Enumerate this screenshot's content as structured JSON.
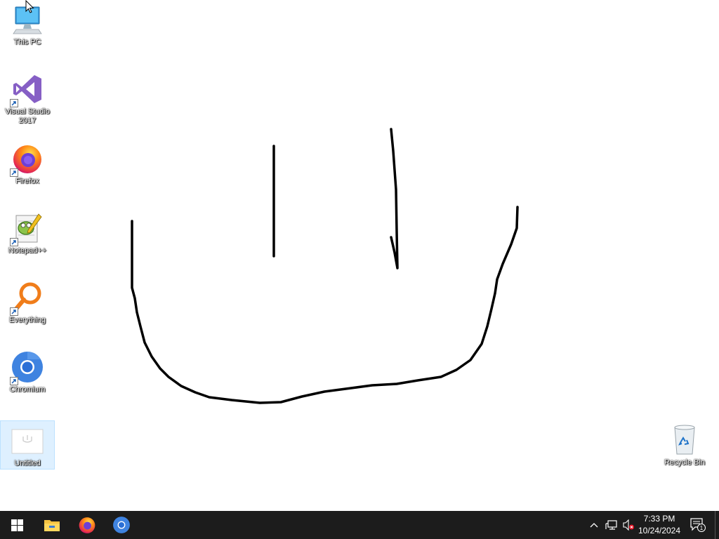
{
  "desktop": {
    "icons": [
      {
        "label": "This PC",
        "icon": "monitor-icon"
      },
      {
        "label": "Visual Studio 2017",
        "icon": "visual-studio-icon"
      },
      {
        "label": "Firefox",
        "icon": "firefox-icon"
      },
      {
        "label": "Notepad++",
        "icon": "notepad-plus-plus-icon"
      },
      {
        "label": "Everything",
        "icon": "magnifier-icon"
      },
      {
        "label": "Chromium",
        "icon": "chromium-icon"
      },
      {
        "label": "Untitled",
        "icon": "blank-document-icon"
      }
    ],
    "recycle_bin": {
      "label": "Recycle Bin",
      "icon": "recycle-bin-icon"
    }
  },
  "taskbar": {
    "start": {
      "icon": "windows-logo-icon"
    },
    "pinned": [
      {
        "icon": "file-explorer-icon"
      },
      {
        "icon": "firefox-icon"
      },
      {
        "icon": "chromium-icon"
      }
    ],
    "tray": {
      "time": "7:33 PM",
      "date": "10/24/2024",
      "notification_count": "1"
    }
  },
  "colors": {
    "taskbar_bg": "#1c1c1c",
    "desktop_bg": "#ffffff",
    "selection": "#cce8ff",
    "stroke": "#000000"
  }
}
